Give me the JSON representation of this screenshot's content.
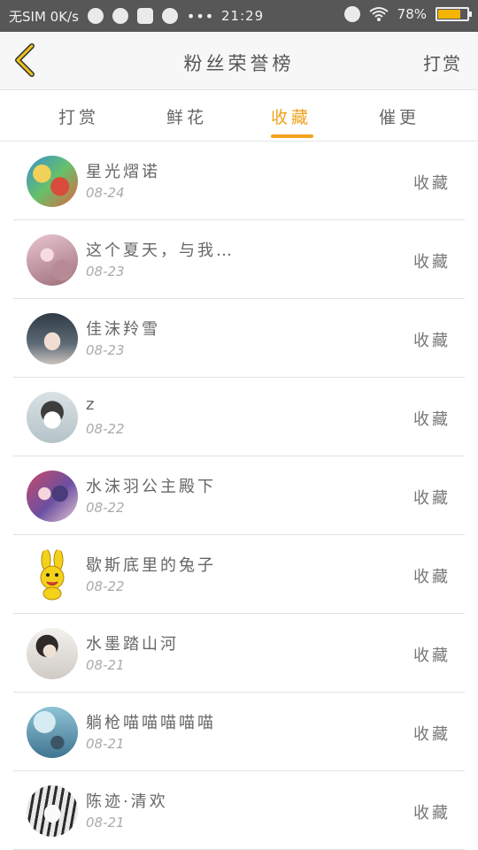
{
  "status_bar": {
    "carrier": "无SIM 0K/s",
    "time": "21:29",
    "dots": "•••",
    "battery_text": "78%",
    "battery_level": 0.78
  },
  "header": {
    "title": "粉丝荣誉榜",
    "action": "打赏"
  },
  "tabs": [
    {
      "label": "打赏"
    },
    {
      "label": "鲜花"
    },
    {
      "label": "收藏"
    },
    {
      "label": "催更"
    }
  ],
  "active_tab": "收藏",
  "list": [
    {
      "name": "星光熠诺",
      "date": "08-24",
      "action": "收藏"
    },
    {
      "name": "这个夏天，与我…",
      "date": "08-23",
      "action": "收藏"
    },
    {
      "name": "佳沫羚雪",
      "date": "08-23",
      "action": "收藏"
    },
    {
      "name": "z",
      "date": "08-22",
      "action": "收藏"
    },
    {
      "name": "水沫羽公主殿下",
      "date": "08-22",
      "action": "收藏"
    },
    {
      "name": "歇斯底里的兔子",
      "date": "08-22",
      "action": "收藏"
    },
    {
      "name": "水墨踏山河",
      "date": "08-21",
      "action": "收藏"
    },
    {
      "name": "躺枪喵喵喵喵喵",
      "date": "08-21",
      "action": "收藏"
    },
    {
      "name": "陈迹·清欢",
      "date": "08-21",
      "action": "收藏"
    }
  ],
  "colors": {
    "accent": "#f0a21b",
    "status_bar": "#575757",
    "header_bg": "#f7f7f7"
  }
}
